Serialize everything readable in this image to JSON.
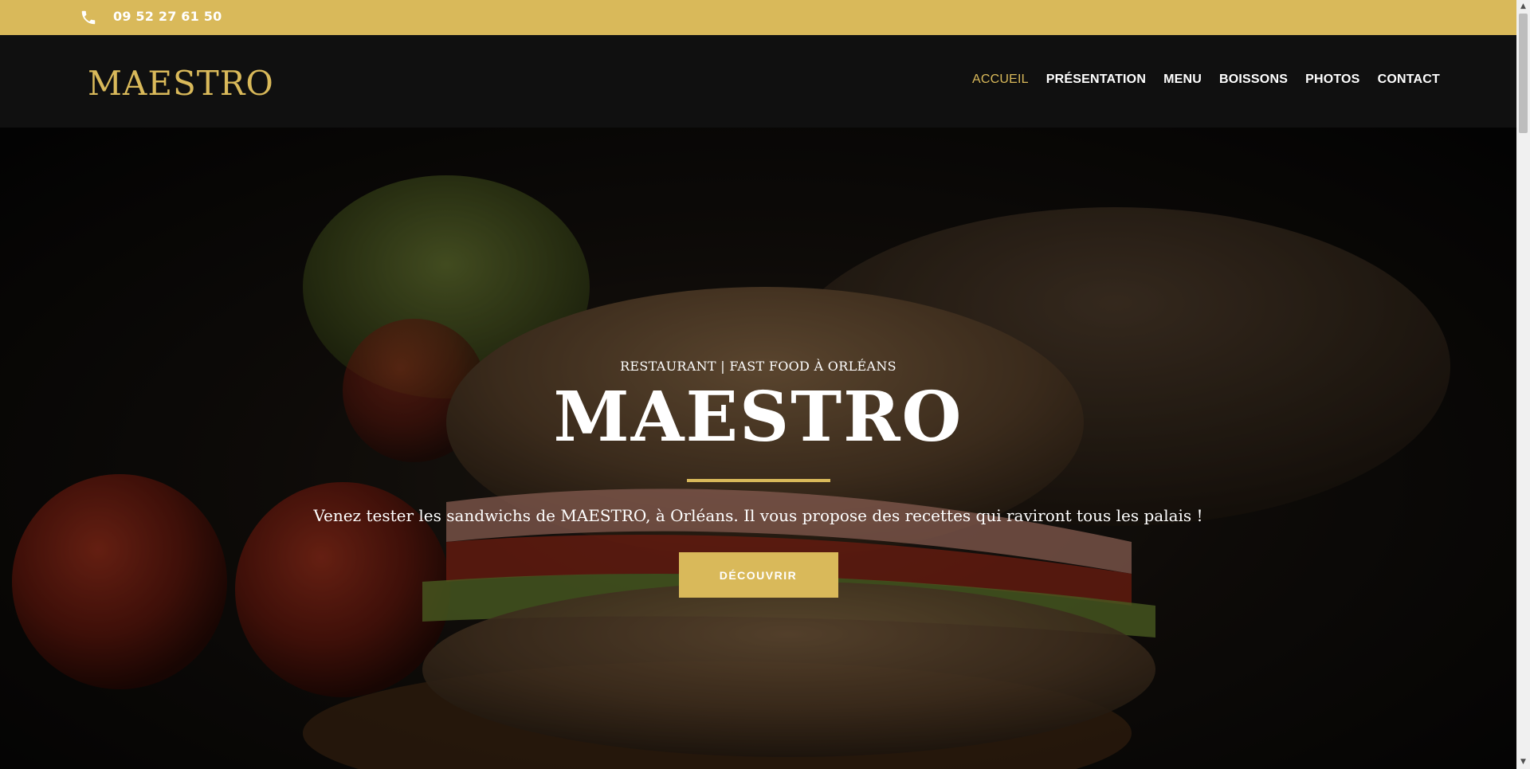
{
  "topbar": {
    "phone_icon": "phone-icon",
    "phone": "09 52 27 61 50",
    "background": "#d9b95a"
  },
  "header": {
    "logo": "MAESTRO",
    "nav": [
      {
        "label": "ACCUEIL",
        "active": true
      },
      {
        "label": "PRÉSENTATION",
        "active": false
      },
      {
        "label": "MENU",
        "active": false
      },
      {
        "label": "BOISSONS",
        "active": false
      },
      {
        "label": "PHOTOS",
        "active": false
      },
      {
        "label": "CONTACT",
        "active": false
      }
    ]
  },
  "hero": {
    "subtitle": "RESTAURANT | FAST FOOD À ORLÉANS",
    "title": "MAESTRO",
    "description": "Venez tester les sandwichs de MAESTRO, à Orléans. Il vous propose des recettes qui raviront tous les palais !",
    "cta": "DÉCOUVRIR",
    "background_image": "sandwich-photo"
  },
  "colors": {
    "accent": "#d9b95a",
    "header_bg": "#101010",
    "text": "#ffffff"
  }
}
